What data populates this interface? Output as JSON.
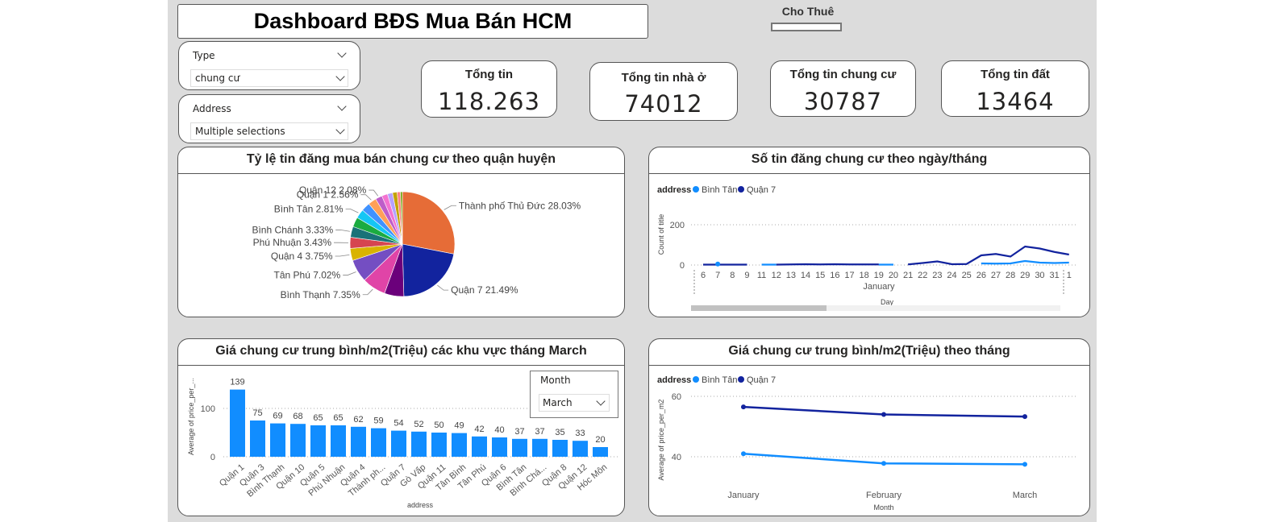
{
  "header": {
    "title": "Dashboard BĐS Mua Bán HCM",
    "toggle_label": "Cho Thuê"
  },
  "slicers": {
    "type": {
      "label": "Type",
      "value": "chung cư"
    },
    "address": {
      "label": "Address",
      "value": "Multiple selections"
    }
  },
  "kpis": [
    {
      "label": "Tổng tin",
      "value": "118.263"
    },
    {
      "label": "Tổng tin nhà ở",
      "value": "74012"
    },
    {
      "label": "Tổng tin chung cư",
      "value": "30787"
    },
    {
      "label": "Tổng tin đất",
      "value": "13464"
    }
  ],
  "month_slicer": {
    "label": "Month",
    "value": "March"
  },
  "colors": {
    "binh_tan": "#118DFF",
    "quan_7": "#12239E",
    "bar": "#118DFF"
  },
  "chart_data": [
    {
      "type": "pie",
      "title": "Tỷ lệ tin đăng mua bán chung cư theo quận huyện",
      "slices": [
        {
          "label": "Thành phố Thủ Đức",
          "value": 28.03,
          "color": "#E66C37",
          "show": true
        },
        {
          "label": "Quận 7",
          "value": 21.49,
          "color": "#12239E",
          "show": true
        },
        {
          "label": "",
          "value": 6.0,
          "color": "#6B007B",
          "show": false
        },
        {
          "label": "Bình Thạnh",
          "value": 7.35,
          "color": "#E044A7",
          "show": true
        },
        {
          "label": "Tân Phú",
          "value": 7.02,
          "color": "#744EC2",
          "show": true
        },
        {
          "label": "Quận 4",
          "value": 3.75,
          "color": "#D9B300",
          "show": true
        },
        {
          "label": "Phú Nhuận",
          "value": 3.43,
          "color": "#D64550",
          "show": true
        },
        {
          "label": "Bình Chánh",
          "value": 3.33,
          "color": "#197278",
          "show": true
        },
        {
          "label": "",
          "value": 3.0,
          "color": "#1AAB40",
          "show": false
        },
        {
          "label": "Bình Tân",
          "value": 2.81,
          "color": "#15C6F4",
          "show": true
        },
        {
          "label": "",
          "value": 2.7,
          "color": "#4092FF",
          "show": false
        },
        {
          "label": "Quận 1",
          "value": 2.56,
          "color": "#FFA058",
          "show": true
        },
        {
          "label": "Quận 12",
          "value": 2.08,
          "color": "#BE5DC9",
          "show": true
        },
        {
          "label": "",
          "value": 1.8,
          "color": "#F472D0",
          "show": false
        },
        {
          "label": "",
          "value": 1.6,
          "color": "#B5A1FF",
          "show": false
        },
        {
          "label": "",
          "value": 1.4,
          "color": "#C4A200",
          "show": false
        },
        {
          "label": "",
          "value": 1.0,
          "color": "#FF8080",
          "show": false
        },
        {
          "label": "",
          "value": 0.61,
          "color": "#6FA60B",
          "show": false
        }
      ]
    },
    {
      "type": "line",
      "title": "Số tin đăng chung cư theo ngày/tháng",
      "legend_title": "address",
      "xlabel": "Day",
      "ylabel": "Count of title",
      "x_group_label": "January",
      "x": [
        "6",
        "7",
        "8",
        "9",
        "11",
        "12",
        "13",
        "14",
        "15",
        "16",
        "17",
        "18",
        "19",
        "20",
        "21",
        "22",
        "23",
        "24",
        "25",
        "26",
        "27",
        "28",
        "29",
        "30",
        "31",
        "1"
      ],
      "ylim": [
        0,
        200
      ],
      "yticks": [
        0,
        200
      ],
      "series": [
        {
          "name": "Bình Tân",
          "values": [
            null,
            5,
            null,
            null,
            2,
            2,
            null,
            null,
            null,
            null,
            null,
            null,
            2,
            2,
            null,
            null,
            null,
            null,
            null,
            8,
            7,
            8,
            20,
            12,
            10,
            12
          ]
        },
        {
          "name": "Quận 7",
          "values": [
            2,
            2,
            2,
            2,
            null,
            2,
            3,
            4,
            3,
            4,
            3,
            3,
            3,
            null,
            3,
            10,
            18,
            4,
            5,
            48,
            55,
            42,
            92,
            82,
            65,
            52
          ]
        }
      ]
    },
    {
      "type": "bar",
      "title": "Giá chung cư trung bình/m2(Triệu) các khu vực tháng March",
      "xlabel": "address",
      "ylabel": "Average of price_per_...",
      "ylim": [
        0,
        150
      ],
      "yticks": [
        0,
        100
      ],
      "categories": [
        "Quận 1",
        "Quận 3",
        "Bình Thạnh",
        "Quận 10",
        "Quận 5",
        "Phú Nhuận",
        "Quận 4",
        "Thành ph...",
        "Quận 7",
        "Gò Vấp",
        "Quận 11",
        "Tân Bình",
        "Tân Phú",
        "Quận 6",
        "Bình Tân",
        "Bình Chá...",
        "Quận 8",
        "Quận 12",
        "Hóc Môn"
      ],
      "values": [
        139,
        75,
        69,
        68,
        65,
        65,
        62,
        59,
        54,
        52,
        50,
        49,
        42,
        40,
        37,
        37,
        35,
        33,
        20
      ]
    },
    {
      "type": "line",
      "title": "Giá chung cư trung bình/m2(Triệu) theo tháng",
      "legend_title": "address",
      "xlabel": "Month",
      "ylabel": "Average of price_per_m2",
      "x": [
        "January",
        "February",
        "March"
      ],
      "ylim": [
        35,
        62
      ],
      "yticks": [
        40,
        60
      ],
      "series": [
        {
          "name": "Bình Tân",
          "values": [
            41,
            37.8,
            37.5
          ]
        },
        {
          "name": "Quận 7",
          "values": [
            56.5,
            54,
            53.3
          ]
        }
      ]
    }
  ]
}
